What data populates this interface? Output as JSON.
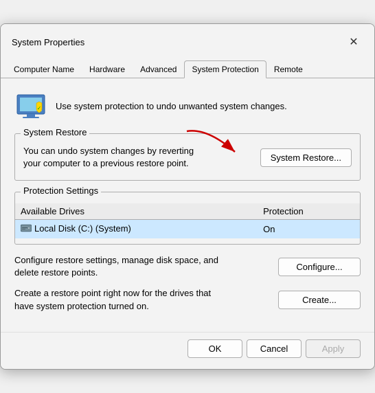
{
  "window": {
    "title": "System Properties",
    "close_label": "✕"
  },
  "tabs": [
    {
      "id": "computer-name",
      "label": "Computer Name",
      "active": false
    },
    {
      "id": "hardware",
      "label": "Hardware",
      "active": false
    },
    {
      "id": "advanced",
      "label": "Advanced",
      "active": false
    },
    {
      "id": "system-protection",
      "label": "System Protection",
      "active": true
    },
    {
      "id": "remote",
      "label": "Remote",
      "active": false
    }
  ],
  "header": {
    "description": "Use system protection to undo unwanted system changes."
  },
  "system_restore": {
    "group_label": "System Restore",
    "description": "You can undo system changes by reverting\nyour computer to a previous restore point.",
    "button_label": "System Restore..."
  },
  "protection_settings": {
    "group_label": "Protection Settings",
    "columns": [
      "Available Drives",
      "Protection"
    ],
    "drives": [
      {
        "name": "Local Disk (C:) (System)",
        "protection": "On",
        "selected": true
      }
    ]
  },
  "configure": {
    "description": "Configure restore settings, manage disk space, and\ndelete restore points.",
    "button_label": "Configure..."
  },
  "create": {
    "description": "Create a restore point right now for the drives that\nhave system protection turned on.",
    "button_label": "Create..."
  },
  "footer": {
    "ok_label": "OK",
    "cancel_label": "Cancel",
    "apply_label": "Apply"
  }
}
